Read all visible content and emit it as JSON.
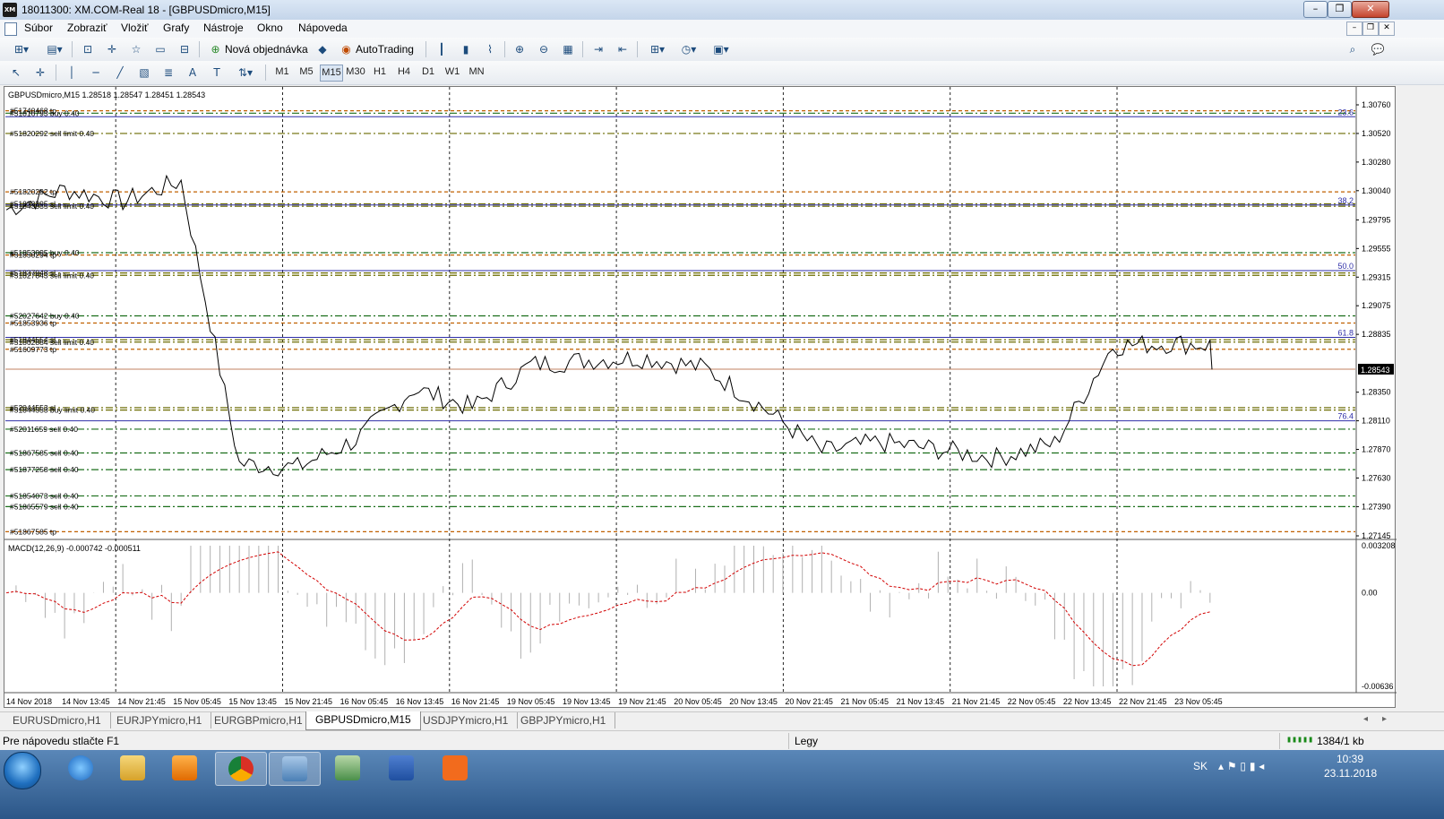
{
  "window": {
    "app_icon": "XM",
    "title": "18011300: XM.COM-Real 18 - [GBPUSDmicro,M15]",
    "controls": [
      "minimize-icon",
      "restore-icon",
      "close-icon"
    ]
  },
  "menu": {
    "items": [
      "Súbor",
      "Zobraziť",
      "Vložiť",
      "Grafy",
      "Nástroje",
      "Okno",
      "Nápoveda"
    ]
  },
  "toolbar": {
    "new_order_label": "Nová objednávka",
    "autotrading_label": "AutoTrading"
  },
  "timeframes": {
    "items": [
      "M1",
      "M5",
      "M15",
      "M30",
      "H1",
      "H4",
      "D1",
      "W1",
      "MN"
    ],
    "active": "M15"
  },
  "chart": {
    "header": "GBPUSDmicro,M15  1.28518 1.28547 1.28451 1.28543",
    "current_price": "1.28543",
    "price_axis": [
      {
        "label": "1.30760",
        "value": 1.3076
      },
      {
        "label": "1.30520",
        "value": 1.3052
      },
      {
        "label": "1.30280",
        "value": 1.3028
      },
      {
        "label": "1.30040",
        "value": 1.3004
      },
      {
        "label": "1.29795",
        "value": 1.29795
      },
      {
        "label": "1.29555",
        "value": 1.29555
      },
      {
        "label": "1.29315",
        "value": 1.29315
      },
      {
        "label": "1.29075",
        "value": 1.29075
      },
      {
        "label": "1.28835",
        "value": 1.28835
      },
      {
        "label": "1.28350",
        "value": 1.2835
      },
      {
        "label": "1.28110",
        "value": 1.2811
      },
      {
        "label": "1.27870",
        "value": 1.2787
      },
      {
        "label": "1.27630",
        "value": 1.2763
      },
      {
        "label": "1.27390",
        "value": 1.2739
      },
      {
        "label": "1.27145",
        "value": 1.27145
      }
    ],
    "fibo_levels": [
      {
        "label": "23.6",
        "value": 1.3066
      },
      {
        "label": "38.2",
        "value": 1.2992
      },
      {
        "label": "50.0",
        "value": 1.2937
      },
      {
        "label": "61.8",
        "value": 1.2881
      },
      {
        "label": "76.4",
        "value": 1.2811
      }
    ],
    "order_labels": [
      {
        "text": "#51740468 tp",
        "value": 1.3071
      },
      {
        "text": "#51816793 buy 0.40",
        "value": 1.3069
      },
      {
        "text": "#51820292 sell limit 0.40",
        "value": 1.3052
      },
      {
        "text": "#51820292 tp",
        "value": 1.3003
      },
      {
        "text": "#51833395 sl",
        "value": 1.2993
      },
      {
        "text": "#51843335 sell limit 0.40",
        "value": 1.2991
      },
      {
        "text": "#51853095 buy 0.40",
        "value": 1.2952
      },
      {
        "text": "#51850294 tp",
        "value": 1.295
      },
      {
        "text": "#51837948 sl",
        "value": 1.2935
      },
      {
        "text": "#51827843 sell limit 0.40",
        "value": 1.2933
      },
      {
        "text": "#52027642 buy 0.40",
        "value": 1.2899
      },
      {
        "text": "#51853936 tp",
        "value": 1.2893
      },
      {
        "text": "#51844554 sl",
        "value": 1.2879
      },
      {
        "text": "#51862884 sell limit 0.40",
        "value": 1.2877
      },
      {
        "text": "#51609773 tp",
        "value": 1.2871
      },
      {
        "text": "#52044553 sl",
        "value": 1.2822
      },
      {
        "text": "#51844553 buy limit 0.40",
        "value": 1.282
      },
      {
        "text": "#52011659 sell 0.40",
        "value": 1.2804
      },
      {
        "text": "#51867585 sell 0.40",
        "value": 1.2784
      },
      {
        "text": "#51877258 sell 0.40",
        "value": 1.277
      },
      {
        "text": "#51854073 sell 0.40",
        "value": 1.2748
      },
      {
        "text": "#51865579 sell 0.40",
        "value": 1.2739
      },
      {
        "text": "#51867585 tp",
        "value": 1.2718
      }
    ],
    "time_axis": [
      "14 Nov 2018",
      "14 Nov 13:45",
      "14 Nov 21:45",
      "15 Nov 05:45",
      "15 Nov 13:45",
      "15 Nov 21:45",
      "16 Nov 05:45",
      "16 Nov 13:45",
      "16 Nov 21:45",
      "19 Nov 05:45",
      "19 Nov 13:45",
      "19 Nov 21:45",
      "20 Nov 05:45",
      "20 Nov 13:45",
      "20 Nov 21:45",
      "21 Nov 05:45",
      "21 Nov 13:45",
      "21 Nov 21:45",
      "22 Nov 05:45",
      "22 Nov 13:45",
      "22 Nov 21:45",
      "23 Nov 05:45"
    ],
    "macd": {
      "header": "MACD(12,26,9) -0.000742 -0.000511",
      "axis": [
        {
          "label": "0.003208",
          "value": 0.003208
        },
        {
          "label": "0.00",
          "value": 0.0
        },
        {
          "label": "-0.00636",
          "value": -0.00636
        }
      ]
    }
  },
  "chart_data": {
    "type": "line",
    "title": "GBPUSDmicro,M15",
    "ylim": [
      1.27145,
      1.3076
    ],
    "x": [
      "14 Nov 2018",
      "14 Nov 13:45",
      "14 Nov 21:45",
      "15 Nov 05:45",
      "15 Nov 13:45",
      "15 Nov 21:45",
      "16 Nov 05:45",
      "16 Nov 13:45",
      "16 Nov 21:45",
      "19 Nov 05:45",
      "19 Nov 13:45",
      "19 Nov 21:45",
      "20 Nov 05:45",
      "20 Nov 13:45",
      "20 Nov 21:45",
      "21 Nov 05:45",
      "21 Nov 13:45",
      "21 Nov 21:45",
      "22 Nov 05:45",
      "22 Nov 13:45",
      "22 Nov 21:45",
      "23 Nov 05:45"
    ],
    "series": [
      {
        "name": "GBPUSDmicro,M15",
        "values": [
          1.2988,
          1.3005,
          1.2995,
          1.3012,
          1.2775,
          1.2772,
          1.2795,
          1.2838,
          1.2822,
          1.2858,
          1.2862,
          1.2864,
          1.2855,
          1.2822,
          1.2785,
          1.2793,
          1.2787,
          1.278,
          1.2792,
          1.2874,
          1.2876,
          1.2874,
          1.2854
        ]
      }
    ],
    "grid": true
  },
  "tabs": {
    "items": [
      "EURUSDmicro,H1",
      "EURJPYmicro,H1",
      "EURGBPmicro,H1",
      "GBPUSDmicro,M15",
      "USDJPYmicro,H1",
      "GBPJPYmicro,H1"
    ],
    "active": "GBPUSDmicro,M15"
  },
  "status": {
    "help": "Pre nápovedu stlačte F1",
    "profile": "Legy",
    "traffic": "1384/1 kb"
  },
  "taskbar": {
    "lang": "SK",
    "time": "10:39",
    "date": "23.11.2018",
    "apps": [
      "ie-icon",
      "explorer-icon",
      "media-player-icon",
      "chrome-icon",
      "terminal-icon",
      "terminal2-icon",
      "word-icon",
      "xiaomi-icon"
    ]
  },
  "colors": {
    "fibo_line": "#2f2fa8",
    "order_line": "#6b6b00",
    "sell_line": "#1a6e1a",
    "tp_line": "#c06000",
    "price_line": "#000000",
    "macd_signal": "#d20000",
    "current_price_bg": "#000000"
  }
}
